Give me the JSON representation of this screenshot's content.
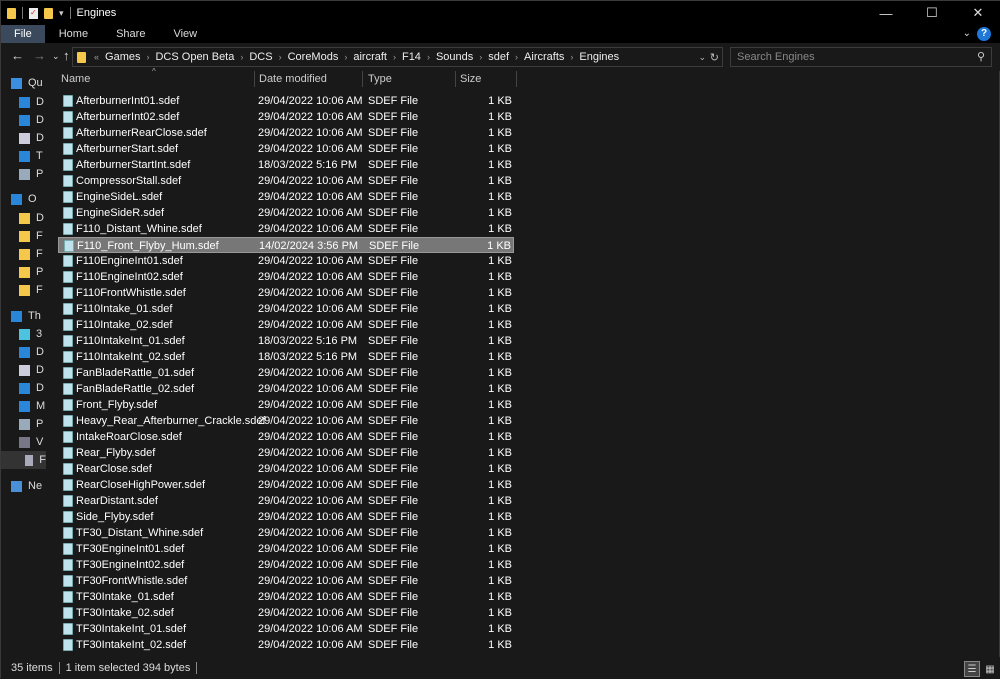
{
  "window": {
    "title": "Engines"
  },
  "ribbon": {
    "tabs": [
      "File",
      "Home",
      "Share",
      "View"
    ]
  },
  "address": {
    "crumbs": [
      "Games",
      "DCS Open Beta",
      "DCS",
      "CoreMods",
      "aircraft",
      "F14",
      "Sounds",
      "sdef",
      "Aircrafts",
      "Engines"
    ]
  },
  "search": {
    "placeholder": "Search Engines"
  },
  "sidebar": {
    "items": [
      {
        "label": "Qu",
        "icon": "star-icon"
      },
      {
        "label": "D",
        "icon": "desktop-icon"
      },
      {
        "label": "D",
        "icon": "download-icon"
      },
      {
        "label": "D",
        "icon": "document-icon"
      },
      {
        "label": "T",
        "icon": "monitor-icon"
      },
      {
        "label": "P",
        "icon": "pictures-icon"
      },
      {
        "label": "O",
        "icon": "cloud-icon"
      },
      {
        "label": "D",
        "icon": "folder-icon"
      },
      {
        "label": "F",
        "icon": "folder-icon"
      },
      {
        "label": "F",
        "icon": "folder-icon"
      },
      {
        "label": "P",
        "icon": "folder-icon"
      },
      {
        "label": "F",
        "icon": "folder-icon"
      },
      {
        "label": "Th",
        "icon": "computer-icon"
      },
      {
        "label": "3",
        "icon": "3d-objects-icon"
      },
      {
        "label": "D",
        "icon": "desktop-icon"
      },
      {
        "label": "D",
        "icon": "document-icon"
      },
      {
        "label": "D",
        "icon": "download-icon"
      },
      {
        "label": "M",
        "icon": "music-icon"
      },
      {
        "label": "P",
        "icon": "pictures-icon"
      },
      {
        "label": "V",
        "icon": "video-icon"
      },
      {
        "label": "F",
        "icon": "drive-icon"
      },
      {
        "label": "Ne",
        "icon": "network-icon"
      }
    ]
  },
  "columns": {
    "name": "Name",
    "date": "Date modified",
    "type": "Type",
    "size": "Size"
  },
  "files": [
    {
      "name": "AfterburnerInt01.sdef",
      "date": "29/04/2022 10:06 AM",
      "type": "SDEF File",
      "size": "1 KB"
    },
    {
      "name": "AfterburnerInt02.sdef",
      "date": "29/04/2022 10:06 AM",
      "type": "SDEF File",
      "size": "1 KB"
    },
    {
      "name": "AfterburnerRearClose.sdef",
      "date": "29/04/2022 10:06 AM",
      "type": "SDEF File",
      "size": "1 KB"
    },
    {
      "name": "AfterburnerStart.sdef",
      "date": "29/04/2022 10:06 AM",
      "type": "SDEF File",
      "size": "1 KB"
    },
    {
      "name": "AfterburnerStartInt.sdef",
      "date": "18/03/2022 5:16 PM",
      "type": "SDEF File",
      "size": "1 KB"
    },
    {
      "name": "CompressorStall.sdef",
      "date": "29/04/2022 10:06 AM",
      "type": "SDEF File",
      "size": "1 KB"
    },
    {
      "name": "EngineSideL.sdef",
      "date": "29/04/2022 10:06 AM",
      "type": "SDEF File",
      "size": "1 KB"
    },
    {
      "name": "EngineSideR.sdef",
      "date": "29/04/2022 10:06 AM",
      "type": "SDEF File",
      "size": "1 KB"
    },
    {
      "name": "F110_Distant_Whine.sdef",
      "date": "29/04/2022 10:06 AM",
      "type": "SDEF File",
      "size": "1 KB"
    },
    {
      "name": "F110_Front_Flyby_Hum.sdef",
      "date": "14/02/2024 3:56 PM",
      "type": "SDEF File",
      "size": "1 KB",
      "selected": true
    },
    {
      "name": "F110EngineInt01.sdef",
      "date": "29/04/2022 10:06 AM",
      "type": "SDEF File",
      "size": "1 KB"
    },
    {
      "name": "F110EngineInt02.sdef",
      "date": "29/04/2022 10:06 AM",
      "type": "SDEF File",
      "size": "1 KB"
    },
    {
      "name": "F110FrontWhistle.sdef",
      "date": "29/04/2022 10:06 AM",
      "type": "SDEF File",
      "size": "1 KB"
    },
    {
      "name": "F110Intake_01.sdef",
      "date": "29/04/2022 10:06 AM",
      "type": "SDEF File",
      "size": "1 KB"
    },
    {
      "name": "F110Intake_02.sdef",
      "date": "29/04/2022 10:06 AM",
      "type": "SDEF File",
      "size": "1 KB"
    },
    {
      "name": "F110IntakeInt_01.sdef",
      "date": "18/03/2022 5:16 PM",
      "type": "SDEF File",
      "size": "1 KB"
    },
    {
      "name": "F110IntakeInt_02.sdef",
      "date": "18/03/2022 5:16 PM",
      "type": "SDEF File",
      "size": "1 KB"
    },
    {
      "name": "FanBladeRattle_01.sdef",
      "date": "29/04/2022 10:06 AM",
      "type": "SDEF File",
      "size": "1 KB"
    },
    {
      "name": "FanBladeRattle_02.sdef",
      "date": "29/04/2022 10:06 AM",
      "type": "SDEF File",
      "size": "1 KB"
    },
    {
      "name": "Front_Flyby.sdef",
      "date": "29/04/2022 10:06 AM",
      "type": "SDEF File",
      "size": "1 KB"
    },
    {
      "name": "Heavy_Rear_Afterburner_Crackle.sdef",
      "date": "29/04/2022 10:06 AM",
      "type": "SDEF File",
      "size": "1 KB"
    },
    {
      "name": "IntakeRoarClose.sdef",
      "date": "29/04/2022 10:06 AM",
      "type": "SDEF File",
      "size": "1 KB"
    },
    {
      "name": "Rear_Flyby.sdef",
      "date": "29/04/2022 10:06 AM",
      "type": "SDEF File",
      "size": "1 KB"
    },
    {
      "name": "RearClose.sdef",
      "date": "29/04/2022 10:06 AM",
      "type": "SDEF File",
      "size": "1 KB"
    },
    {
      "name": "RearCloseHighPower.sdef",
      "date": "29/04/2022 10:06 AM",
      "type": "SDEF File",
      "size": "1 KB"
    },
    {
      "name": "RearDistant.sdef",
      "date": "29/04/2022 10:06 AM",
      "type": "SDEF File",
      "size": "1 KB"
    },
    {
      "name": "Side_Flyby.sdef",
      "date": "29/04/2022 10:06 AM",
      "type": "SDEF File",
      "size": "1 KB"
    },
    {
      "name": "TF30_Distant_Whine.sdef",
      "date": "29/04/2022 10:06 AM",
      "type": "SDEF File",
      "size": "1 KB"
    },
    {
      "name": "TF30EngineInt01.sdef",
      "date": "29/04/2022 10:06 AM",
      "type": "SDEF File",
      "size": "1 KB"
    },
    {
      "name": "TF30EngineInt02.sdef",
      "date": "29/04/2022 10:06 AM",
      "type": "SDEF File",
      "size": "1 KB"
    },
    {
      "name": "TF30FrontWhistle.sdef",
      "date": "29/04/2022 10:06 AM",
      "type": "SDEF File",
      "size": "1 KB"
    },
    {
      "name": "TF30Intake_01.sdef",
      "date": "29/04/2022 10:06 AM",
      "type": "SDEF File",
      "size": "1 KB"
    },
    {
      "name": "TF30Intake_02.sdef",
      "date": "29/04/2022 10:06 AM",
      "type": "SDEF File",
      "size": "1 KB"
    },
    {
      "name": "TF30IntakeInt_01.sdef",
      "date": "29/04/2022 10:06 AM",
      "type": "SDEF File",
      "size": "1 KB"
    },
    {
      "name": "TF30IntakeInt_02.sdef",
      "date": "29/04/2022 10:06 AM",
      "type": "SDEF File",
      "size": "1 KB"
    }
  ],
  "status": {
    "count": "35 items",
    "selection": "1 item selected  394 bytes"
  },
  "colors": {
    "folder": "#f5c84c",
    "selection": "#777777",
    "accent": "#1e78d8"
  }
}
